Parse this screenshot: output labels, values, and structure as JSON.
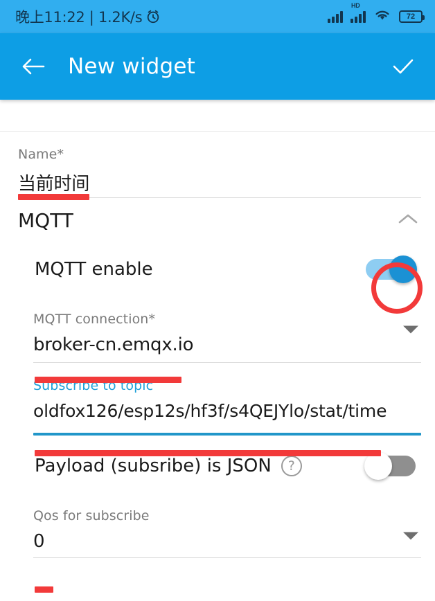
{
  "status_bar": {
    "time_text": "晚上11:22 | 1.2K/s",
    "alarm_icon": "alarm-clock-icon",
    "signal_icon": "signal-bars-icon",
    "signal_hd_label": "HD",
    "wifi_icon": "wifi-icon",
    "battery_level": "72",
    "background_color": "#31aeef"
  },
  "app_bar": {
    "back_icon": "back-arrow-icon",
    "title": "New widget",
    "confirm_icon": "checkmark-icon",
    "background_color": "#0d9ee5"
  },
  "form": {
    "name_field": {
      "label": "Name*",
      "value": "当前时间"
    },
    "mqtt_section": {
      "title": "MQTT",
      "collapse_icon": "chevron-up-icon"
    },
    "mqtt_enable": {
      "label": "MQTT enable",
      "state": "on"
    },
    "mqtt_connection": {
      "label": "MQTT connection*",
      "value": "broker-cn.emqx.io",
      "dropdown_icon": "dropdown-arrow-icon"
    },
    "subscribe_topic": {
      "label": "Subscribe to topic",
      "value": "oldfox126/esp12s/hf3f/s4QEJYlo/stat/time",
      "focused": true,
      "focus_color": "#2196c9"
    },
    "payload_json": {
      "label": "Payload (subsribe) is JSON",
      "help_icon": "help-circle-icon",
      "help_glyph": "?",
      "state": "off"
    },
    "qos_subscribe": {
      "label": "Qos for subscribe",
      "value": "0",
      "dropdown_icon": "dropdown-arrow-icon"
    }
  },
  "annotations": {
    "color": "#f23a3a",
    "name_underline": "red-underline-name",
    "connection_underline": "red-underline-connection",
    "topic_underline": "red-underline-topic",
    "qos_underline": "red-underline-qos",
    "toggle_circle": "red-circle-mqtt-enable"
  }
}
